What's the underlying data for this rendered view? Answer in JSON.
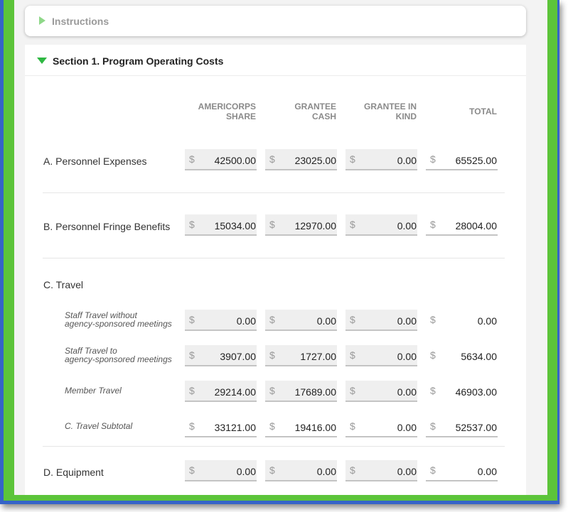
{
  "instructions": {
    "label": "Instructions"
  },
  "section": {
    "title": "Section 1. Program Operating Costs"
  },
  "columns": [
    "AMERICORPS\nSHARE",
    "GRANTEE\nCASH",
    "GRANTEE IN\nKIND",
    "TOTAL"
  ],
  "currency_symbol": "$",
  "rows": {
    "personnel": {
      "label": "A. Personnel Expenses",
      "values": [
        "42500.00",
        "23025.00",
        "0.00",
        "65525.00"
      ]
    },
    "fringe": {
      "label": "B. Personnel Fringe Benefits",
      "values": [
        "15034.00",
        "12970.00",
        "0.00",
        "28004.00"
      ]
    },
    "travel": {
      "label": "C. Travel"
    },
    "staff_travel_without": {
      "label": "Staff Travel without\nagency-sponsored meetings",
      "values": [
        "0.00",
        "0.00",
        "0.00",
        "0.00"
      ]
    },
    "staff_travel_to": {
      "label": "Staff Travel to\nagency-sponsored meetings",
      "values": [
        "3907.00",
        "1727.00",
        "0.00",
        "5634.00"
      ]
    },
    "member_travel": {
      "label": "Member Travel",
      "values": [
        "29214.00",
        "17689.00",
        "0.00",
        "46903.00"
      ]
    },
    "travel_subtotal": {
      "label": "C. Travel Subtotal",
      "values": [
        "33121.00",
        "19416.00",
        "0.00",
        "52537.00"
      ]
    },
    "equipment": {
      "label": "D. Equipment",
      "values": [
        "0.00",
        "0.00",
        "0.00",
        "0.00"
      ]
    }
  },
  "colors": {
    "frame_blue": "#3564c8",
    "frame_green": "#5cc43a",
    "expand_triangle": "#2fb843"
  }
}
